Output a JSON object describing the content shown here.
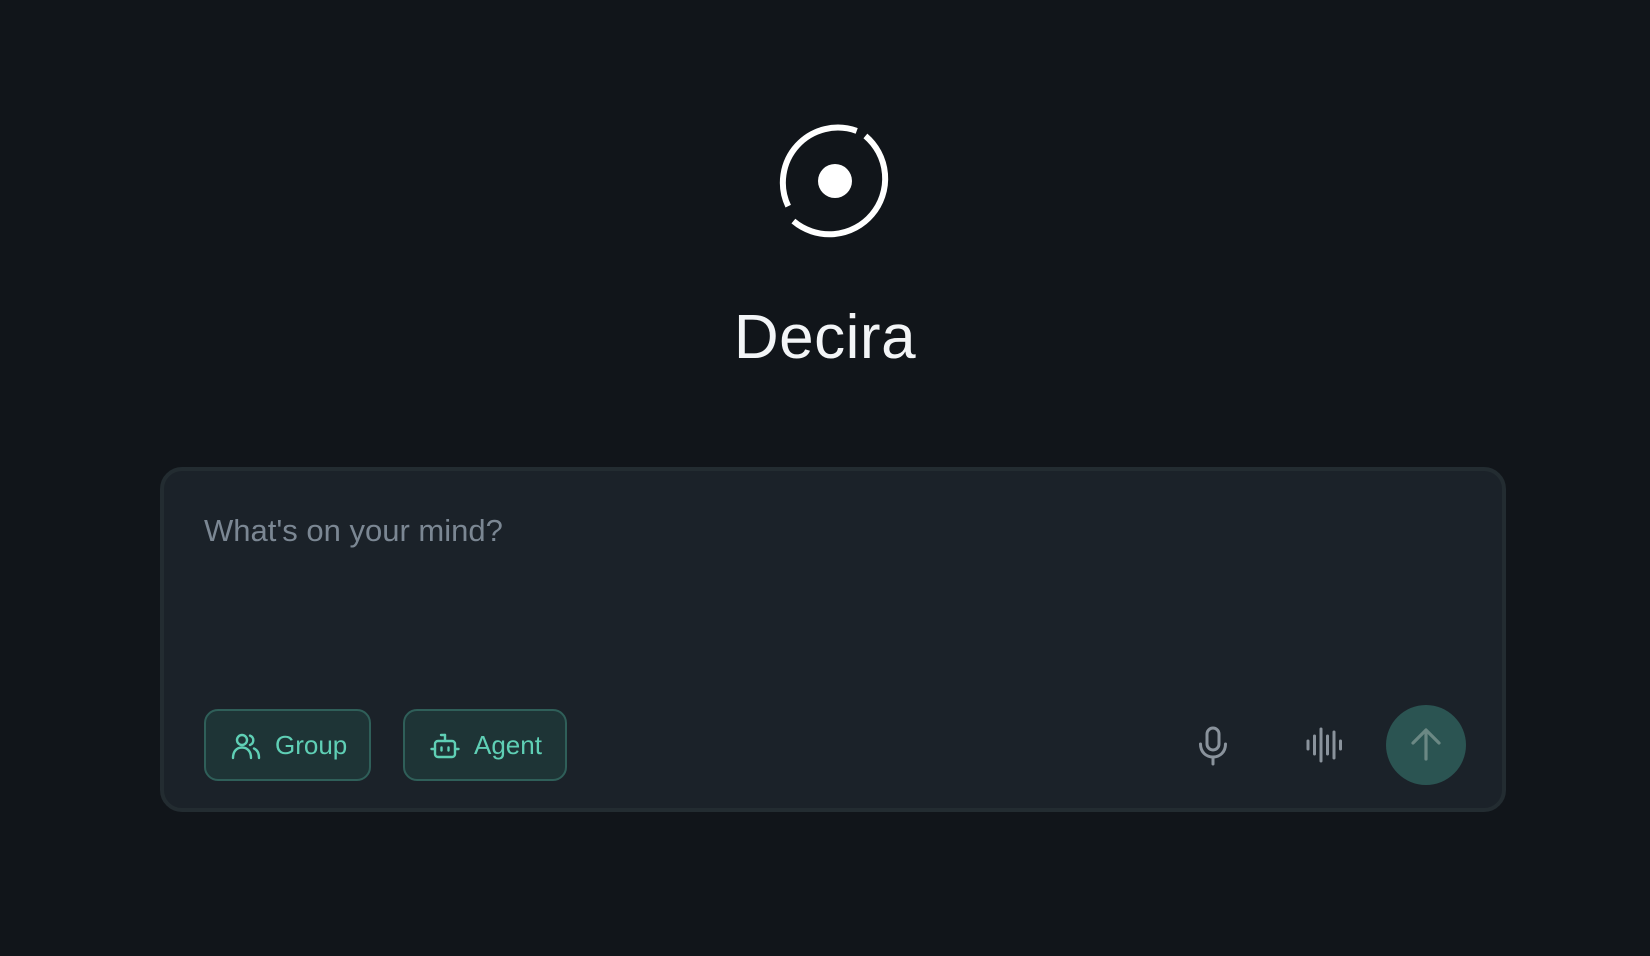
{
  "app": {
    "title": "Decira",
    "logo_icon": "ring-dot-logo-icon"
  },
  "composer": {
    "placeholder": "What's on your mind?",
    "value": "",
    "buttons": {
      "group": {
        "label": "Group",
        "icon": "users-icon"
      },
      "agent": {
        "label": "Agent",
        "icon": "robot-icon"
      },
      "microphone": {
        "icon": "microphone-icon"
      },
      "voice_mode": {
        "icon": "audio-waveform-icon"
      },
      "send": {
        "icon": "arrow-up-icon"
      }
    }
  },
  "colors": {
    "background": "#11151a",
    "composer_background": "#1b2229",
    "composer_border": "#232c31",
    "accent": "#5fcfb5",
    "pill_background": "#1e3436",
    "pill_border": "#2f5f59",
    "send_background": "#2b5452",
    "icon_muted": "#8a939c",
    "title": "#f3f5f7"
  }
}
